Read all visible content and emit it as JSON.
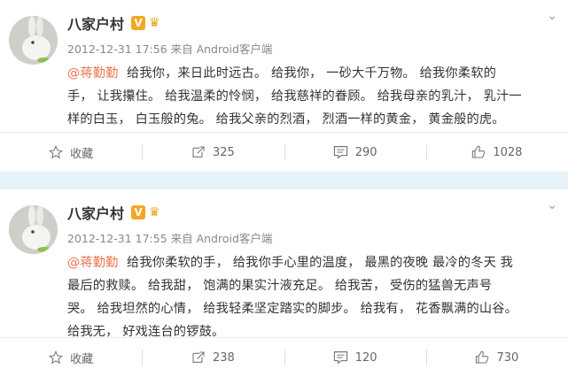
{
  "posts": [
    {
      "author": "八家户村",
      "verified_badge": "V",
      "meta": "2012-12-31 17:56 来自 Android客户端",
      "mention": "@蒋勤勤",
      "lines": [
        "给我你，来日此时远古。 给我你， 一砂大千万物。 给我你柔软的",
        "手， 让我攥住。 给我温柔的怜悯， 给我慈祥的眷顾。 给我母亲的乳汁， 乳汁一",
        "样的白玉， 白玉般的兔。 给我父亲的烈酒， 烈酒一样的黄金， 黄金般的虎。"
      ],
      "actions": {
        "favorite": "收藏",
        "repost": "325",
        "comment": "290",
        "like": "1028"
      }
    },
    {
      "author": "八家户村",
      "verified_badge": "V",
      "meta": "2012-12-31 17:55 来自 Android客户端",
      "mention": "@蒋勤勤",
      "lines": [
        "给我你柔软的手， 给我你手心里的温度， 最黑的夜晚 最冷的冬天 我",
        "最后的救赎。 给我甜， 饱满的果实汁液充足。 给我苦， 受伤的猛兽无声号",
        "哭。 给我坦然的心情， 给我轻柔坚定踏实的脚步。 给我有， 花香飘满的山谷。",
        "给我无， 好戏连台的锣鼓。"
      ],
      "actions": {
        "favorite": "收藏",
        "repost": "238",
        "comment": "120",
        "like": "730"
      }
    }
  ],
  "colors": {
    "mention": "#eb7350",
    "badge": "#f5a623",
    "divider": "#e6f3fb"
  },
  "icons": [
    "avatar-rabbit",
    "verified-v-icon",
    "crown-icon",
    "chevron-down-icon",
    "star-icon",
    "repost-icon",
    "comment-icon",
    "like-icon"
  ]
}
